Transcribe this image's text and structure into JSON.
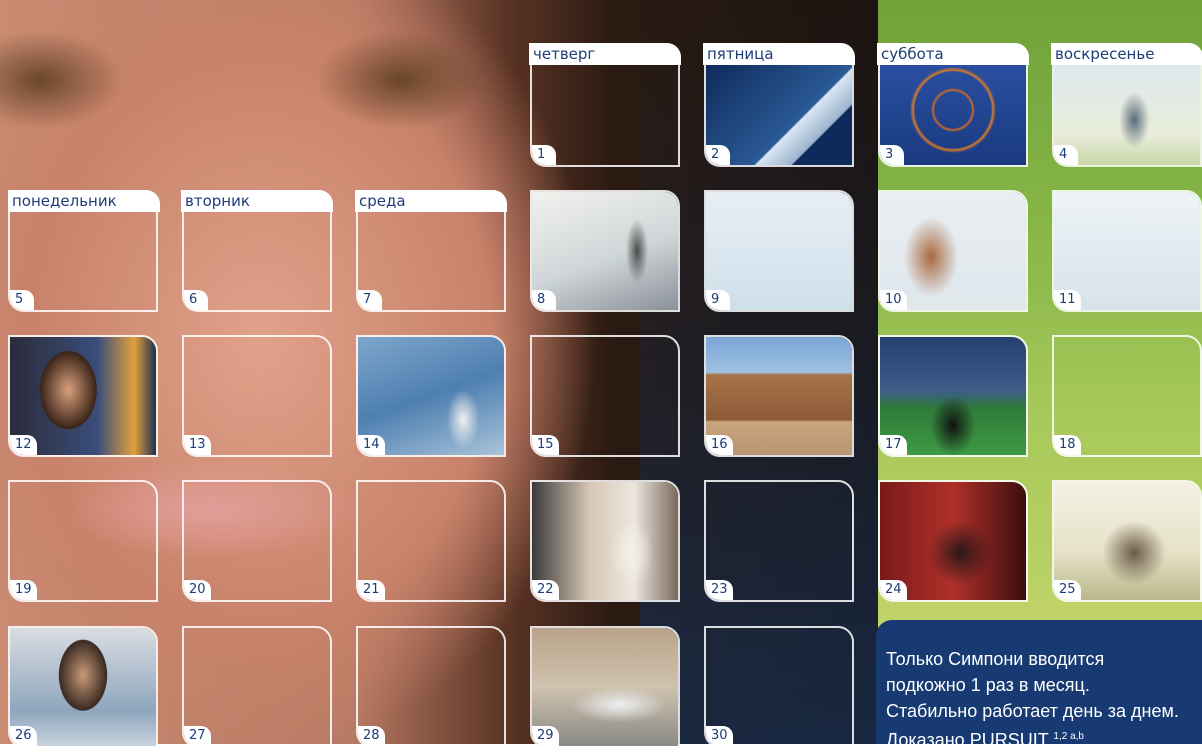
{
  "days": {
    "mon": "понедельник",
    "tue": "вторник",
    "wed": "среда",
    "thu": "четверг",
    "fri": "пятница",
    "sat": "суббота",
    "sun": "воскресенье"
  },
  "cells": [
    "1",
    "2",
    "3",
    "4",
    "5",
    "6",
    "7",
    "8",
    "9",
    "10",
    "11",
    "12",
    "13",
    "14",
    "15",
    "16",
    "17",
    "18",
    "19",
    "20",
    "21",
    "22",
    "23",
    "24",
    "25",
    "26",
    "27",
    "28",
    "29",
    "30"
  ],
  "info": {
    "line1": "Только Симпони вводится",
    "line2": "подкожно 1 раз в месяц.",
    "line3": "Стабильно работает день за днем.",
    "line4": "Доказано PURSUIT",
    "line4_sup": "1,2 a,b"
  },
  "colors": {
    "brand_blue": "#1d3c78",
    "panel_blue": "#173a72",
    "green": "#8bb94a"
  }
}
